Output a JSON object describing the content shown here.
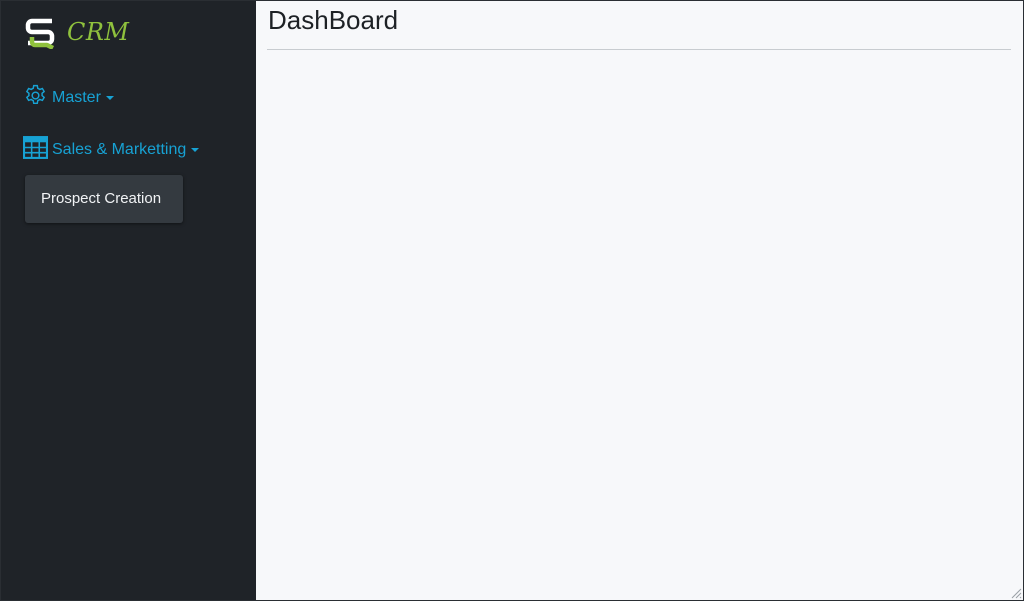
{
  "brand": {
    "name": "CRM",
    "logo_letter": "SQ",
    "accent_color": "#8fc13d"
  },
  "sidebar": {
    "items": [
      {
        "label": "Master",
        "icon": "gear-icon",
        "has_dropdown": true
      },
      {
        "label": "Sales & Marketting",
        "icon": "table-grid-icon",
        "has_dropdown": true
      }
    ],
    "dropdown": {
      "items": [
        {
          "label": "Prospect Creation"
        }
      ]
    },
    "link_color": "#17a2d4"
  },
  "main": {
    "title": "DashBoard"
  }
}
